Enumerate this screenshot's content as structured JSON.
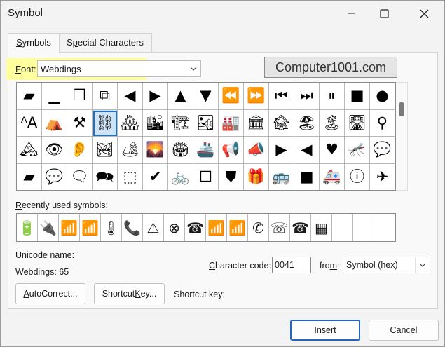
{
  "window": {
    "title": "Symbol",
    "minimize_glyph": "—",
    "maximize_glyph": "☐",
    "close_glyph": "✕"
  },
  "tabs": [
    {
      "label": "Symbols",
      "mnemonic": "S",
      "rest": "ymbols",
      "active": true
    },
    {
      "label": "Special Characters",
      "prefix": "S",
      "mnemonic": "p",
      "rest": "ecial Characters",
      "active": false
    }
  ],
  "font": {
    "label_mnemonic": "F",
    "label_rest": "ont:",
    "value": "Webdings"
  },
  "watermark": "Computer1001.com",
  "symbol_grid": {
    "selected_index": 18,
    "cells": [
      "▰",
      "▁",
      "❐",
      "⧉",
      "◀",
      "▶",
      "▲",
      "▼",
      "⏪",
      "⏩",
      "⏮",
      "⏭",
      "⏸",
      "■",
      "●",
      "ᴬA",
      "⛺",
      "⚒",
      "⛓",
      "🏘",
      "🏙",
      "🏗",
      "🏜",
      "🏭",
      "🏛",
      "🏚",
      "🏖",
      "🏝",
      "🛣",
      "⚲",
      "🏔",
      "👁",
      "👂",
      "🏞",
      "🏕",
      "🌄",
      "🏟",
      "🚢",
      "📢",
      "📣",
      "▶",
      "◀",
      "♥",
      "🦟",
      "💬",
      "▰",
      "💬",
      "🗨",
      "🗪",
      "⬚",
      "✔",
      "🚲",
      "☐",
      "⛊",
      "🎁",
      "🚌",
      "■",
      "🚑",
      "ⓘ",
      "✈"
    ]
  },
  "recent": {
    "label_mnemonic": "R",
    "label_rest": "ecently used symbols:",
    "cells": [
      "🔋",
      "🔌",
      "📶",
      "📶",
      "🌡",
      "📞",
      "⚠",
      "⊗",
      "☎",
      "📶",
      "📶",
      "✆",
      "☏",
      "☎",
      "▦",
      "",
      "",
      ""
    ]
  },
  "unicode_name_label": "Unicode name:",
  "unicode_name_value": "Webdings: 65",
  "character_code": {
    "label_prefix": "",
    "label_mnemonic": "C",
    "label_rest": "haracter code:",
    "value": "0041"
  },
  "from": {
    "label_prefix": "fro",
    "label_mnemonic": "m",
    "label_rest": ":",
    "value": "Symbol (hex)"
  },
  "buttons": {
    "autocorrect": {
      "mnemonic": "A",
      "rest": "utoCorrect..."
    },
    "shortcut_key": {
      "prefix": "Shortcut ",
      "mnemonic": "K",
      "rest": "ey..."
    },
    "insert": {
      "mnemonic": "I",
      "rest": "nsert"
    },
    "cancel": "Cancel"
  },
  "shortcut_key_label": "Shortcut key:"
}
